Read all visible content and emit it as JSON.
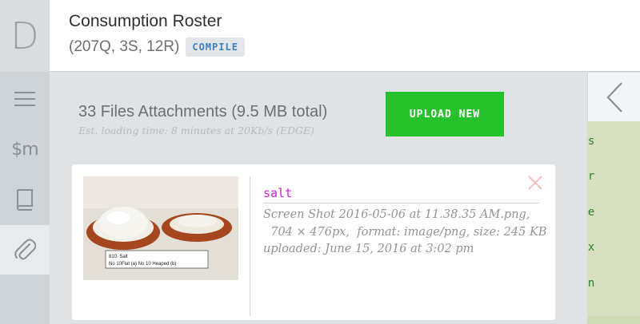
{
  "app": {
    "logo_letter": "D"
  },
  "rail": {
    "items": [
      {
        "icon": "menu-icon",
        "label": ""
      },
      {
        "icon": "dollar-m-icon",
        "label": "$m"
      },
      {
        "icon": "book-icon",
        "label": ""
      },
      {
        "icon": "paperclip-icon",
        "label": "",
        "active": true
      }
    ]
  },
  "header": {
    "title": "Consumption Roster",
    "subtitle": "(207Q, 3S, 12R)",
    "compile_label": "COMPILE"
  },
  "attachments": {
    "summary": "33 Files Attachments (9.5 MB total)",
    "est_loading": "Est. loading time: 8 minutes at 20Kb/s (EDGE)",
    "upload_label": "UPLOAD NEW",
    "files": [
      {
        "name": "salt",
        "filename": "Screen Shot 2016-05-06 at 11.38.35 AM.png,",
        "details": "  704 × 476px,  format: image/png, size: 245 KB",
        "uploaded": "uploaded: June 15, 2016 at 3:02 pm",
        "thumb_caption_line1": "810. Salt",
        "thumb_caption_line2": "No 10Flat (a) No 10 Heaped (b)"
      }
    ]
  },
  "code_panel": {
    "lines": [
      "ers",
      "ter",
      "ame",
      "sex",
      "ion"
    ]
  },
  "colors": {
    "accent_green": "#26c22c",
    "compile_blue": "#3d7fc0",
    "filename_magenta": "#d11fcf",
    "code_green": "#2e7d32"
  }
}
